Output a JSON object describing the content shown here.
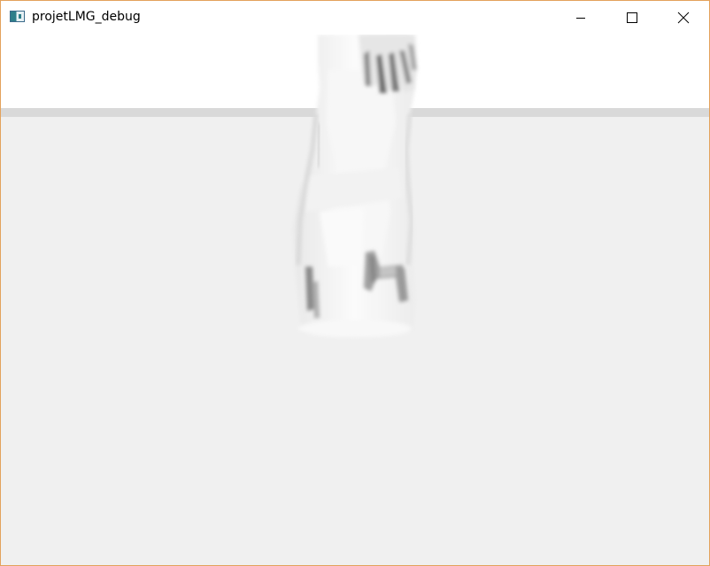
{
  "window": {
    "title": "projetLMG_debug",
    "icon": "app-window-icon",
    "controls": {
      "minimize": "minimize-icon",
      "maximize": "maximize-icon",
      "close": "close-icon"
    },
    "border_color": "#e3a25c"
  },
  "scene": {
    "background_color": "#f0f0f0",
    "sky_color": "#ffffff",
    "horizon_color": "#d9d9d9"
  }
}
